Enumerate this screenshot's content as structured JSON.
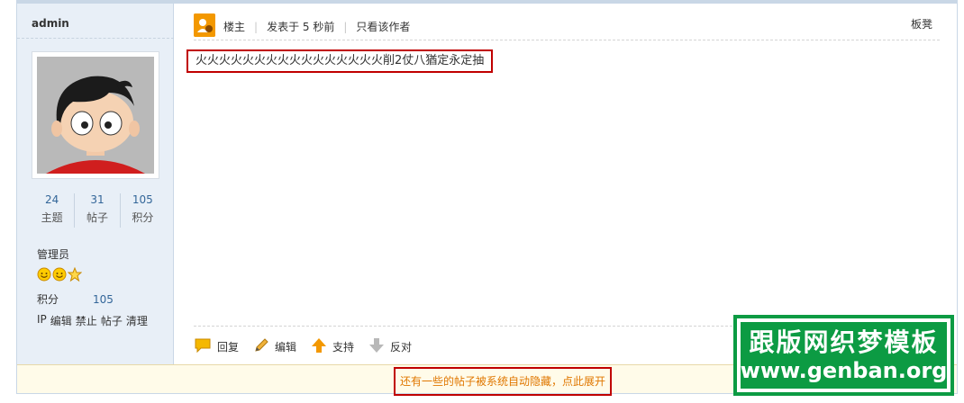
{
  "author": {
    "name": "admin",
    "stats": [
      {
        "value": "24",
        "label": "主题"
      },
      {
        "value": "31",
        "label": "帖子"
      },
      {
        "value": "105",
        "label": "积分"
      }
    ],
    "group": "管理员",
    "points_label": "积分",
    "points_value": "105",
    "admin_links": [
      "IP",
      "编辑",
      "禁止",
      "帖子",
      "清理"
    ]
  },
  "post": {
    "owner_label": "楼主",
    "posted_at": "发表于 5 秒前",
    "author_only": "只看该作者",
    "floor": "板凳",
    "content": "火火火火火火火火火火火火火火火火削2仗八猶定永定抽",
    "actions": [
      {
        "icon": "reply-icon",
        "label": "回复"
      },
      {
        "icon": "edit-pencil-icon",
        "label": "编辑"
      },
      {
        "icon": "support-up-arrow-icon",
        "label": "支持"
      },
      {
        "icon": "oppose-down-arrow-icon",
        "label": "反对"
      }
    ]
  },
  "hidden_notice": "还有一些的帖子被系统自动隐藏，点此展开",
  "watermark": {
    "title": "跟版网织梦模板",
    "url": "www.genban.org"
  },
  "colors": {
    "sidebar_bg": "#e8eff7",
    "link_blue": "#336699",
    "highlight_red": "#c00000",
    "notice_orange": "#e07700",
    "watermark_green": "#0c9b43"
  }
}
